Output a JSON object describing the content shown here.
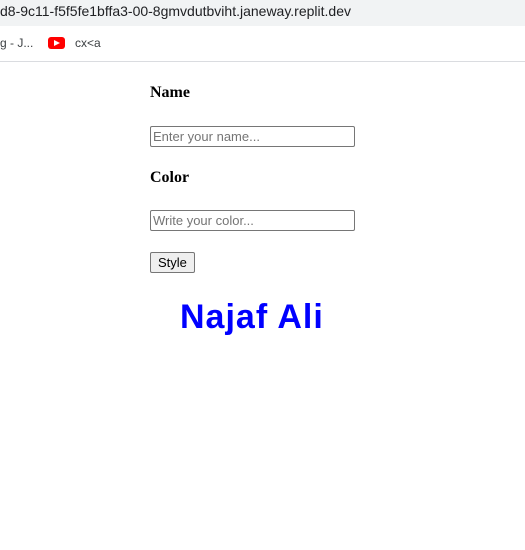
{
  "browser": {
    "url": "d8-9c11-f5f5fe1bffa3-00-8gmvdutbviht.janeway.replit.dev",
    "bookmarks": [
      {
        "label": "g - J..."
      },
      {
        "label": "cx<a",
        "icon": "youtube-icon"
      }
    ]
  },
  "form": {
    "name_label": "Name",
    "name_placeholder": "Enter your name...",
    "color_label": "Color",
    "color_placeholder": "Write your color...",
    "style_button": "Style"
  },
  "output": {
    "text": "Najaf Ali",
    "color": "#0000ff"
  }
}
